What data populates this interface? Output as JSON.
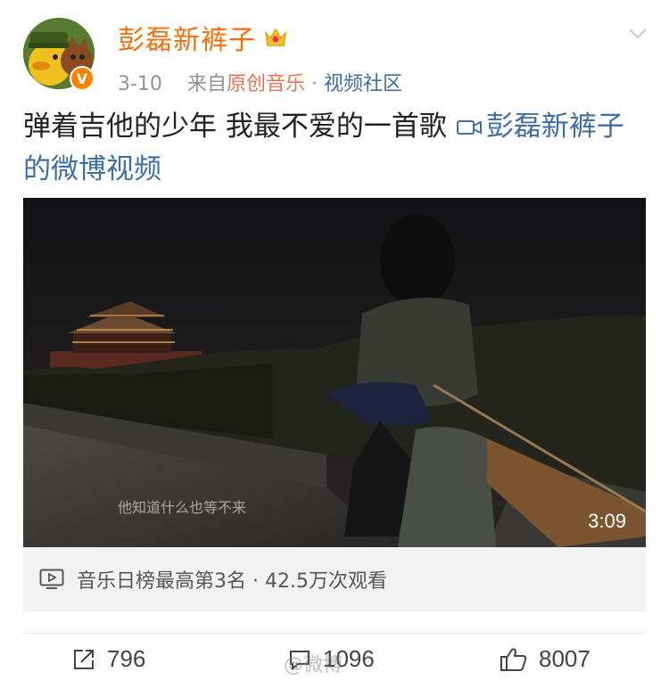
{
  "post": {
    "username": "彭磊新裤子",
    "badge_icon": "crown-vip-icon",
    "date": "3-10",
    "from_label": "来自",
    "source": "原创音乐",
    "separator": " · ",
    "community": "视频社区",
    "text_main": "弹着吉他的少年 我最不爱的一首歌",
    "video_link": "彭磊新裤子的微博视频",
    "verified_mark": "V"
  },
  "video": {
    "subtitle": "他知道什么也等不来",
    "duration": "3:09"
  },
  "stats": {
    "text": "音乐日榜最高第3名 · 42.5万次观看"
  },
  "actions": {
    "repost_count": "796",
    "comment_count": "1096",
    "like_count": "8007"
  },
  "watermark": "@微博"
}
